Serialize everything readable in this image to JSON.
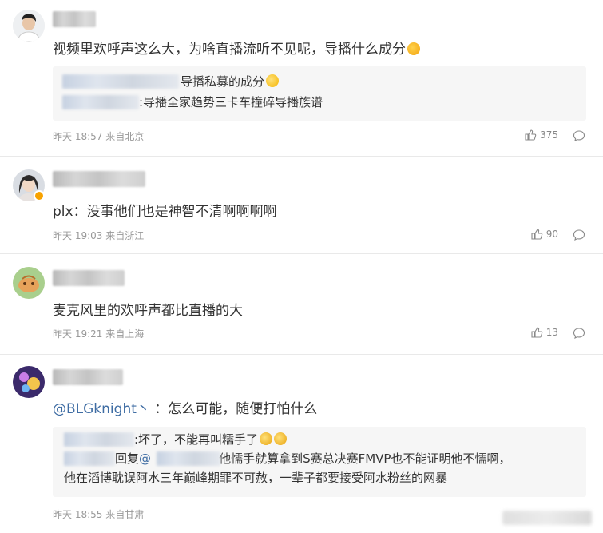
{
  "comments": [
    {
      "text": "视频里欢呼声这么大，为啥直播流听不见呢，导播什么成分",
      "quote": [
        {
          "text": "导播私募的成分"
        },
        {
          "text": ":导播全家趋势三卡车撞碎导播族谱"
        }
      ],
      "time": "昨天 18:57",
      "location": "来自北京",
      "likes": "375"
    },
    {
      "text": "plx：没事他们也是神智不清啊啊啊啊",
      "time": "昨天 19:03",
      "location": "来自浙江",
      "likes": "90"
    },
    {
      "text": "麦克风里的欢呼声都比直播的大",
      "time": "昨天 19:21",
      "location": "来自上海",
      "likes": "13"
    },
    {
      "mention": "@BLGknight丶",
      "text": "：怎么可能，随便打怕什么",
      "quote": [
        {
          "text": ":坏了，不能再叫糯手了"
        },
        {
          "prefix": "回复",
          "mention": "@",
          "text": ":他懦手就算拿到S赛总决赛FMVP也不能证明他不懦啊，"
        },
        {
          "text": "他在滔博耽误阿水三年巅峰期罪不可赦，一辈子都要接受阿水粉丝的网暴"
        }
      ],
      "time": "昨天 18:55",
      "location": "来自甘肃"
    }
  ],
  "colors": {
    "link": "#3e6ca3",
    "meta": "#999999",
    "quote_bg": "#f6f6f6"
  },
  "icons": {
    "like": "thumbs-up-icon",
    "reply": "comment-bubble-icon"
  }
}
